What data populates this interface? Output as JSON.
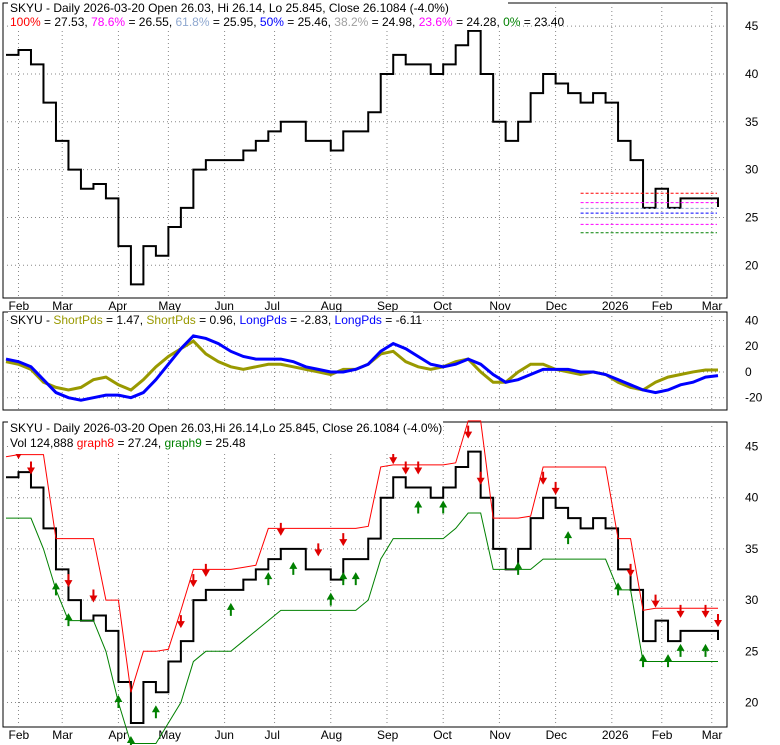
{
  "chart_data": [
    {
      "type": "line",
      "title": "SKYU - Daily 2026-03-20 Open 26.03, Hi 26.14, Lo 25.845, Close 26.1084 (-4.0%)",
      "fib": [
        {
          "label": "100%",
          "value": 27.53,
          "text": "= 27.53, ",
          "color": "#ff0000"
        },
        {
          "label": "78.6%",
          "value": 26.55,
          "text": "= 26.55, ",
          "color": "#ff00ff"
        },
        {
          "label": "61.8%",
          "value": 25.95,
          "text": "= 25.95, ",
          "color": "#8fa8d0"
        },
        {
          "label": "50%",
          "value": 25.46,
          "text": "= 25.46, ",
          "color": "#0000ff"
        },
        {
          "label": "38.2%",
          "value": 24.98,
          "text": "= 24.98, ",
          "color": "#a0a0a0"
        },
        {
          "label": "23.6%",
          "value": 24.28,
          "text": "= 24.28, ",
          "color": "#ff00ff"
        },
        {
          "label": "0%",
          "value": 23.4,
          "text": "= 23.40",
          "color": "#008000"
        }
      ],
      "yticks": [
        20,
        25,
        30,
        35,
        40,
        45
      ],
      "ylim": [
        17,
        47
      ],
      "months": [
        "Feb",
        "Mar",
        "Apr",
        "May",
        "Jun",
        "Jul",
        "Aug",
        "Sep",
        "Oct",
        "Nov",
        "Dec",
        "2026",
        "Feb",
        "Mar"
      ],
      "month_week": [
        1,
        4.5,
        9,
        13,
        17.5,
        21.5,
        26,
        30.5,
        35,
        39.5,
        44,
        48.5,
        52.5,
        56.5
      ],
      "close": [
        42,
        42.5,
        41,
        37,
        33,
        30,
        28,
        28.5,
        27,
        22,
        18,
        22,
        21,
        24,
        26,
        30,
        31,
        31,
        31,
        32,
        33,
        34,
        35,
        35,
        33,
        33,
        32,
        34,
        34,
        36,
        40,
        42,
        41,
        41,
        40,
        41,
        43,
        44.5,
        40,
        35,
        33,
        35,
        38,
        40,
        39,
        38,
        37,
        38,
        37,
        33,
        31,
        26,
        28,
        26,
        27,
        27,
        27,
        26.1
      ]
    },
    {
      "type": "line",
      "title": "SKYU - ",
      "legend": [
        {
          "name": "ShortPds",
          "text": " = 1.47, ",
          "color": "#999900"
        },
        {
          "name": "ShortPds",
          "text": " = 0.96, ",
          "color": "#999900"
        },
        {
          "name": "LongPds",
          "text": " = -2.83, ",
          "color": "#0000ff"
        },
        {
          "name": "LongPds",
          "text": " = -6.11",
          "color": "#0000ff"
        }
      ],
      "yticks": [
        -20,
        0,
        20,
        40
      ],
      "ylim": [
        -28,
        45
      ],
      "short": [
        8,
        6,
        2,
        -8,
        -12,
        -14,
        -12,
        -6,
        -4,
        -10,
        -14,
        -6,
        4,
        12,
        18,
        24,
        14,
        8,
        4,
        2,
        4,
        6,
        6,
        4,
        2,
        0,
        -2,
        2,
        2,
        6,
        14,
        16,
        8,
        4,
        2,
        4,
        8,
        10,
        0,
        -8,
        -8,
        0,
        6,
        6,
        2,
        0,
        -2,
        0,
        -2,
        -8,
        -12,
        -14,
        -8,
        -4,
        -2,
        0,
        1.5,
        1.47
      ],
      "long": [
        10,
        8,
        4,
        -6,
        -16,
        -20,
        -22,
        -20,
        -18,
        -18,
        -20,
        -16,
        -6,
        6,
        18,
        28,
        26,
        22,
        16,
        12,
        10,
        10,
        10,
        8,
        4,
        2,
        0,
        0,
        2,
        6,
        16,
        22,
        18,
        12,
        6,
        4,
        6,
        10,
        6,
        -2,
        -8,
        -6,
        -2,
        2,
        2,
        2,
        0,
        0,
        -2,
        -6,
        -10,
        -14,
        -16,
        -14,
        -10,
        -8,
        -4,
        -2.83
      ]
    },
    {
      "type": "line",
      "title": "SKYU - Daily 2026-03-20 Open 26.03,Hi 26.14,Lo 25.845, Close 26.1084 (-4.0%)",
      "vol": "Vol 124,888",
      "legend": [
        {
          "name": "graph8",
          "text": " = 27.24, ",
          "color": "#ff0000"
        },
        {
          "name": "graph9",
          "text": " = 25.48",
          "color": "#008000"
        }
      ],
      "yticks": [
        20,
        25,
        30,
        35,
        40,
        45
      ],
      "ylim": [
        18,
        47
      ],
      "sell_weeks": [
        1,
        2,
        5,
        7,
        14,
        15,
        16,
        22,
        25,
        27,
        31,
        32,
        33,
        37,
        38,
        43,
        44,
        50,
        52,
        54,
        56,
        58
      ],
      "buy_weeks": [
        4,
        5,
        9,
        10,
        12,
        18,
        21,
        23,
        26,
        27,
        28,
        33,
        35,
        41,
        45,
        49,
        51,
        53,
        54,
        56
      ]
    }
  ]
}
